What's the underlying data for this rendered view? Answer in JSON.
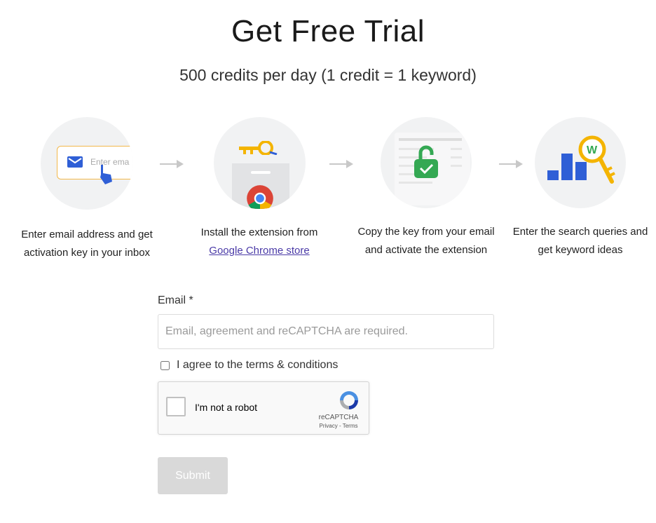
{
  "header": {
    "title": "Get Free Trial",
    "subtitle": "500 credits per day (1 credit = 1 keyword)"
  },
  "steps": [
    {
      "icon": "email-input-illustration",
      "text": "Enter email address and get activation key in your inbox",
      "input_preview": "Enter ema"
    },
    {
      "icon": "chrome-store-illustration",
      "text_before": "Install the extension from",
      "link": "Google Chrome store"
    },
    {
      "icon": "unlock-key-illustration",
      "text": "Copy the key from your email and activate the extension"
    },
    {
      "icon": "keyword-ideas-illustration",
      "text": "Enter the search queries and get keyword ideas"
    }
  ],
  "form": {
    "email_label": "Email *",
    "email_placeholder": "Email, agreement and reCAPTCHA are required.",
    "agree_label": "I agree to the terms & conditions",
    "captcha_label": "I'm not a robot",
    "captcha_brand": "reCAPTCHA",
    "captcha_links": "Privacy - Terms",
    "submit_label": "Submit"
  },
  "colors": {
    "accent_blue": "#2f5fd6",
    "key_yellow": "#f4b400",
    "lock_green": "#34a853",
    "submit_disabled": "#d9d9d9"
  }
}
